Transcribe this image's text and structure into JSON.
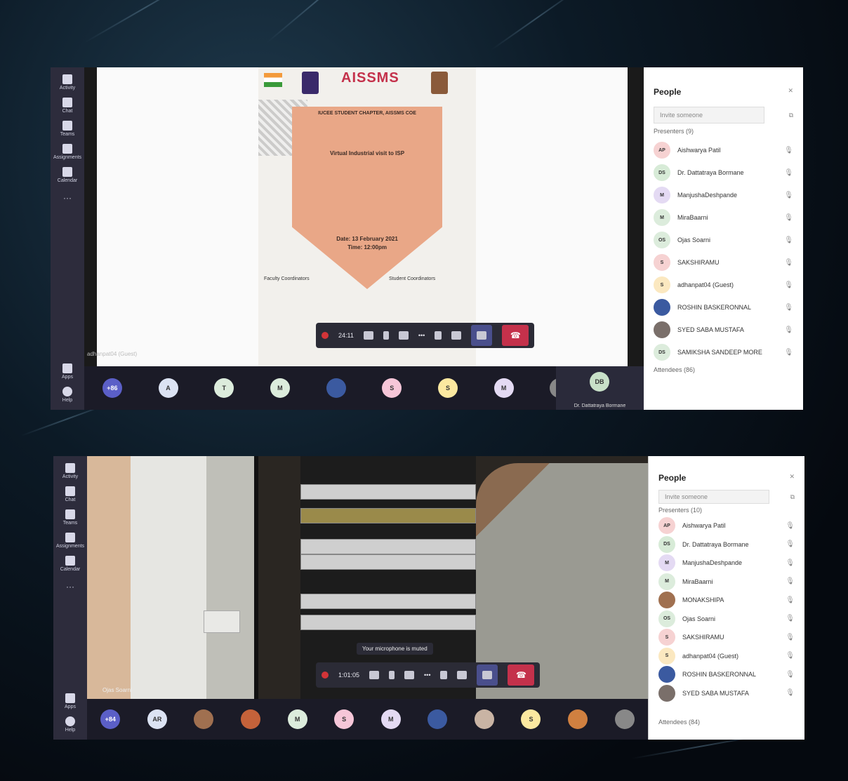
{
  "colors": {
    "rail": "#2d2c3c",
    "teams_purple": "#4a4f8c",
    "leave_red": "#c4314b"
  },
  "shot1": {
    "poster": {
      "logo_text": "AISSMS",
      "line1": "IUCEE STUDENT CHAPTER, AISSMS COE",
      "line2": "Virtual Industrial visit to ISP",
      "date": "Date: 13 February 2021",
      "time": "Time: 12:00pm",
      "fac_head": "Faculty Coordinators",
      "stu_head": "Student Coordinators"
    },
    "tile_label": "adhanpat04 (Guest)",
    "call_timer": "24:11",
    "people": {
      "title": "People",
      "invite": "Invite someone",
      "presenters": "Presenters (9)",
      "attendees": "Attendees (86)",
      "rows": [
        {
          "initials": "AP",
          "name": "Aishwarya Patil",
          "color": "#f6d2d2"
        },
        {
          "initials": "DS",
          "name": "Dr. Dattatraya Bormane",
          "color": "#d7ebd7"
        },
        {
          "initials": "M",
          "name": "ManjushaDeshpande",
          "color": "#e4daf3"
        },
        {
          "initials": "M",
          "name": "MiraBaarni",
          "color": "#dcecdc"
        },
        {
          "initials": "OS",
          "name": "Ojas Soarni",
          "color": "#dcecdc"
        },
        {
          "initials": "S",
          "name": "SAKSHIRAMU",
          "color": "#f6d2d2"
        },
        {
          "initials": "S",
          "name": "adhanpat04 (Guest)",
          "color": "#fbe8c0"
        },
        {
          "initials": "",
          "name": "ROSHIN BASKERONNAL",
          "color": "#3b5aa0"
        },
        {
          "initials": "",
          "name": "SYED SABA MUSTAFA",
          "color": "#7a6f6a"
        },
        {
          "initials": "DS",
          "name": "SAMIKSHA SANDEEP MORE",
          "color": "#dcecdc"
        }
      ]
    },
    "bar_label": "Dr. Dattatraya Bormane",
    "bar_initials": "DB",
    "bar_avatars": [
      "+86",
      "A",
      "T",
      "M",
      "",
      "S",
      "S",
      "M",
      "",
      "",
      ""
    ]
  },
  "shot2": {
    "tile_label": "Ojas Soarni",
    "toast": "Your microphone is muted",
    "call_timer": "1:01:05",
    "people": {
      "title": "People",
      "invite": "Invite someone",
      "presenters": "Presenters (10)",
      "attendees": "Attendees (84)",
      "rows": [
        {
          "initials": "AP",
          "name": "Aishwarya Patil",
          "color": "#f6d2d2"
        },
        {
          "initials": "DS",
          "name": "Dr. Dattatraya Bormane",
          "color": "#d7ebd7"
        },
        {
          "initials": "M",
          "name": "ManjushaDeshpande",
          "color": "#e4daf3"
        },
        {
          "initials": "M",
          "name": "MiraBaarni",
          "color": "#dcecdc"
        },
        {
          "initials": "",
          "name": "MONAKSHIPA",
          "color": "#a07050"
        },
        {
          "initials": "OS",
          "name": "Ojas Soarni",
          "color": "#dcecdc"
        },
        {
          "initials": "S",
          "name": "SAKSHIRAMU",
          "color": "#f6d2d2"
        },
        {
          "initials": "S",
          "name": "adhanpat04 (Guest)",
          "color": "#fbe8c0"
        },
        {
          "initials": "",
          "name": "ROSHIN BASKERONNAL",
          "color": "#3b5aa0"
        },
        {
          "initials": "",
          "name": "SYED SABA MUSTAFA",
          "color": "#7a6f6a"
        }
      ]
    },
    "bar_avatars": [
      "+84",
      "AR",
      "",
      "",
      "M",
      "S",
      "M",
      "",
      "",
      "S",
      "",
      ""
    ]
  },
  "rail": {
    "items": [
      "Activity",
      "Chat",
      "Teams",
      "Assignments",
      "Calendar"
    ],
    "bottom": [
      "Apps",
      "Help"
    ]
  }
}
